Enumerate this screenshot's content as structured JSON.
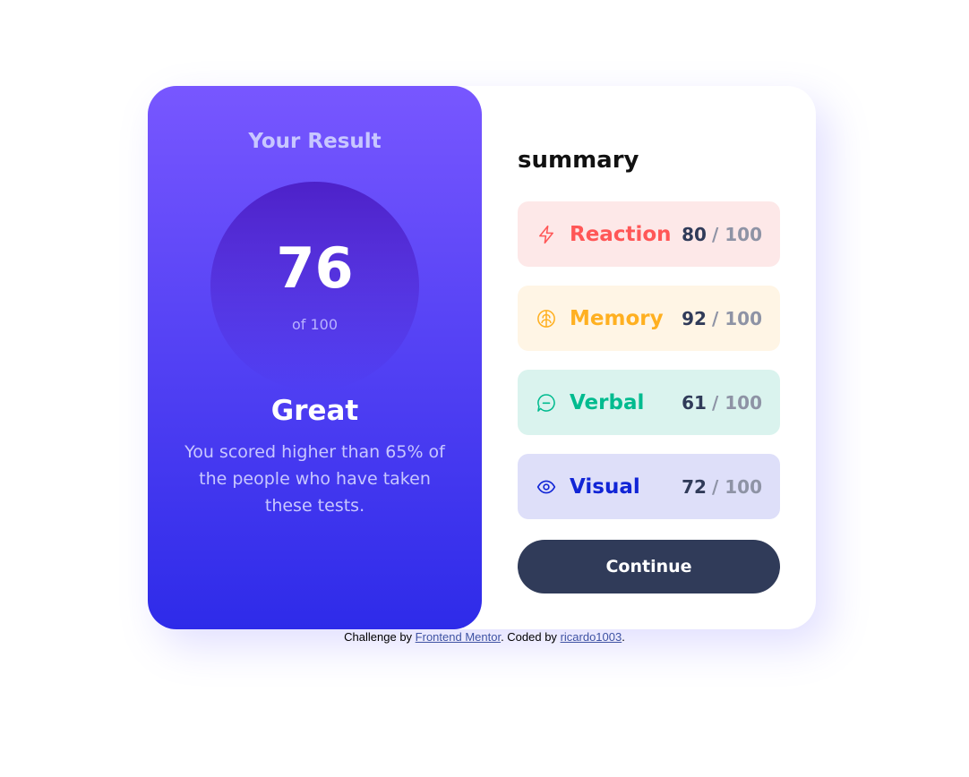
{
  "result": {
    "title": "Your Result",
    "score": "76",
    "total": "of 100",
    "rating": "Great",
    "description": "You scored higher than 65% of the people who have taken these tests."
  },
  "summary": {
    "title": "summary",
    "items": [
      {
        "label": "Reaction",
        "score": "80",
        "max": "/ 100",
        "icon": "lightning-icon",
        "color": "#ff5757"
      },
      {
        "label": "Memory",
        "score": "92",
        "max": "/ 100",
        "icon": "brain-icon",
        "color": "#ffb021"
      },
      {
        "label": "Verbal",
        "score": "61",
        "max": "/ 100",
        "icon": "chat-bubble-icon",
        "color": "#00bb8f"
      },
      {
        "label": "Visual",
        "score": "72",
        "max": "/ 100",
        "icon": "eye-icon",
        "color": "#1125d6"
      }
    ],
    "continue_label": "Continue"
  },
  "attribution": {
    "prefix": "Challenge by",
    "link1": "Frontend Mentor",
    "middle": ". Coded by",
    "link2": "ricardo1003",
    "suffix": "."
  }
}
